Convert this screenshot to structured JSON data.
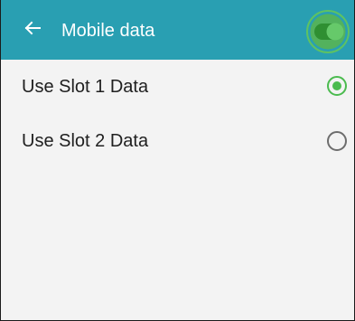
{
  "header": {
    "title": "Mobile data",
    "back_icon": "arrow-left-icon",
    "switch_on": true
  },
  "options": [
    {
      "label": "Use Slot 1 Data",
      "selected": true
    },
    {
      "label": "Use Slot 2 Data",
      "selected": false
    }
  ],
  "colors": {
    "header_bg": "#299fb2",
    "accent": "#4bbb4f",
    "page_bg": "#f3f3f3",
    "text": "#202020"
  }
}
